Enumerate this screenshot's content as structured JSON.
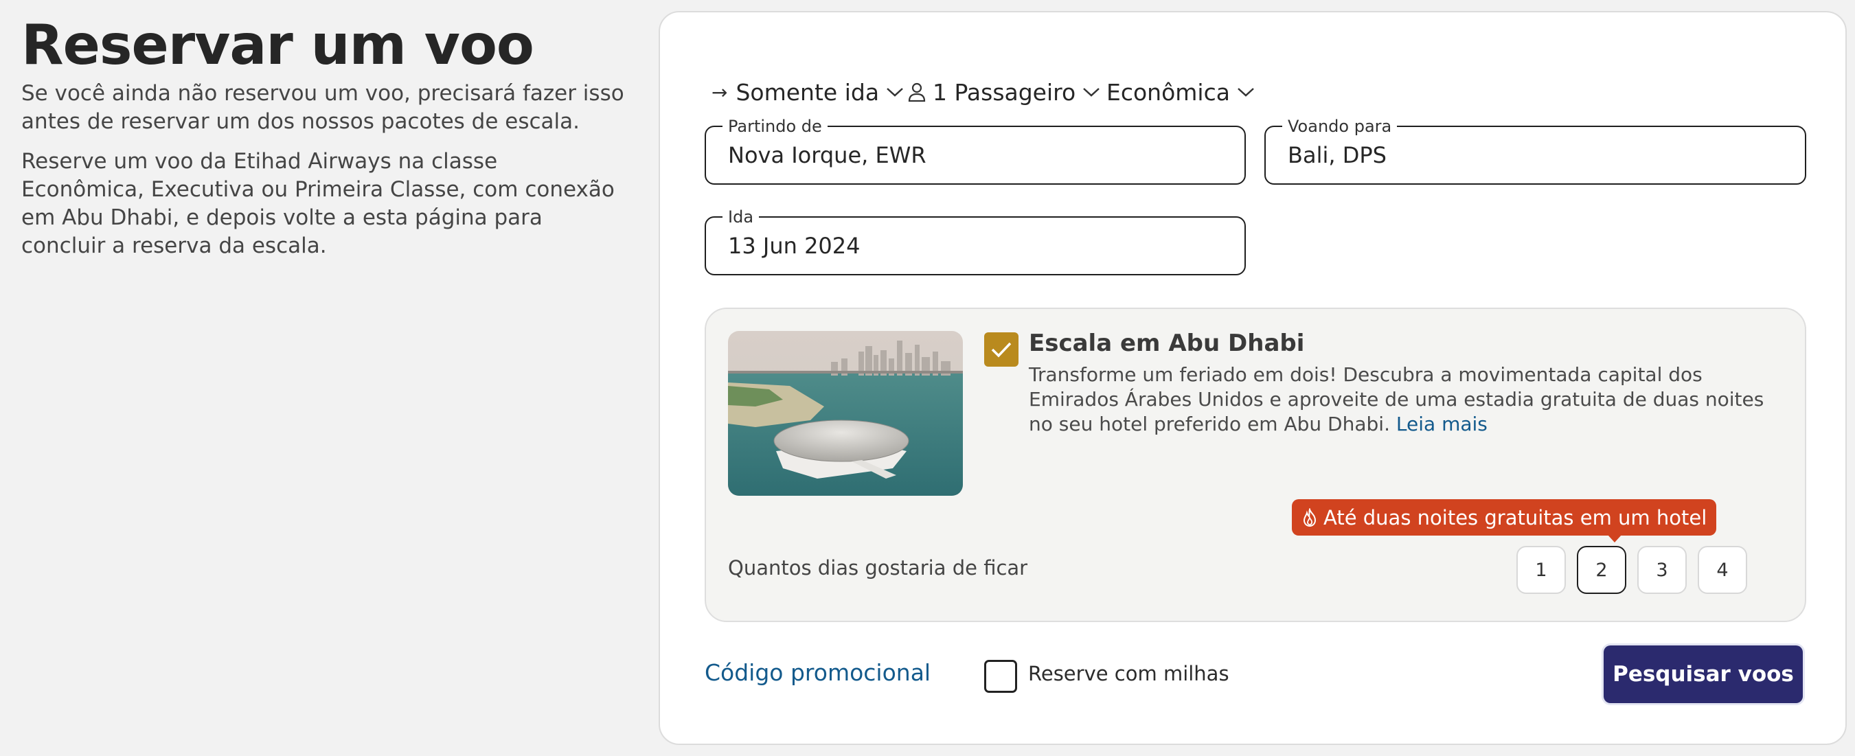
{
  "intro": {
    "title": "Reservar um voo",
    "para1": "Se você ainda não reservou um voo, precisará fazer isso antes de reservar um dos nossos pacotes de escala.",
    "para2": "Reserve um voo da Etihad Airways na classe Econômica, Executiva ou Primeira Classe, com conexão em Abu Dhabi, e depois volte a esta página para concluir a reserva da escala."
  },
  "options": {
    "trip_type": "Somente ida",
    "passengers": "1 Passageiro",
    "cabin": "Econômica"
  },
  "fields": {
    "from_label": "Partindo de",
    "from_value": "Nova Iorque, EWR",
    "to_label": "Voando para",
    "to_value": "Bali, DPS",
    "depart_label": "Ida",
    "depart_value": "13 Jun 2024"
  },
  "stopover": {
    "checked": true,
    "title": "Escala em Abu Dhabi",
    "description": "Transforme um feriado em dois! Descubra a movimentada capital dos Emirados Árabes Unidos e aproveite de uma estadia gratuita de duas noites no seu hotel preferido em Abu Dhabi.",
    "read_more": "Leia mais",
    "badge": "Até duas noites gratuitas em um hotel",
    "days_label": "Quantos dias gostaria de ficar",
    "days": [
      "1",
      "2",
      "3",
      "4"
    ],
    "selected_day": "2"
  },
  "footer": {
    "promo": "Código promocional",
    "miles_label": "Reserve com milhas",
    "miles_checked": false,
    "search_button": "Pesquisar voos"
  },
  "colors": {
    "accent_gold": "#b98a1e",
    "badge_red": "#d1431f",
    "button_navy": "#2b2a6e",
    "link_blue": "#135a8c"
  }
}
